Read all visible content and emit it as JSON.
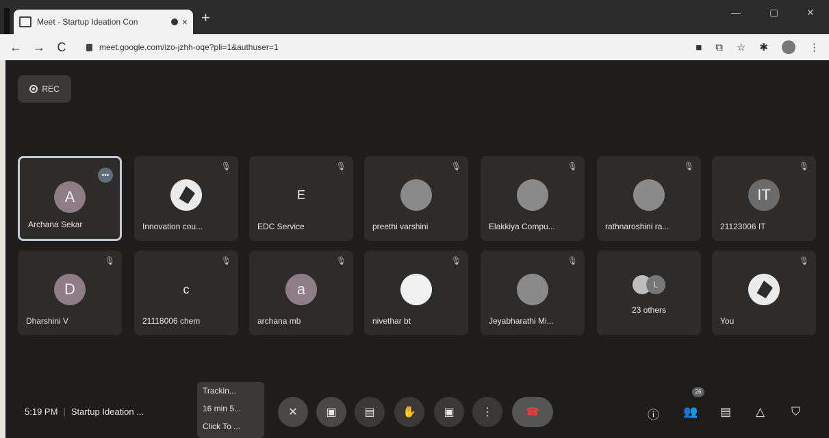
{
  "browser": {
    "tab_title": "Meet - Startup Ideation Con",
    "tab_close": "×",
    "new_tab": "+",
    "url": "meet.google.com/izo-jzhh-oqe?pli=1&authuser=1",
    "nav": {
      "back": "←",
      "forward": "→",
      "reload": "C"
    },
    "toolbar_icons": [
      "camera-icon",
      "share-page-icon",
      "star-icon",
      "extensions-icon",
      "profile-avatar",
      "menu-icon"
    ],
    "toolbar_glyphs": {
      "star": "☆",
      "more": "⋮"
    }
  },
  "meeting": {
    "rec_label": "REC",
    "tiles": [
      {
        "name": "Archana Sekar",
        "initial": "A",
        "avatar": "mauve",
        "active": true,
        "speaking": true
      },
      {
        "name": "Innovation cou...",
        "initial": "",
        "avatar": "logo"
      },
      {
        "name": "EDC Service",
        "initial": "E",
        "avatar": "none"
      },
      {
        "name": "preethi varshini",
        "initial": "",
        "avatar": "photo"
      },
      {
        "name": "Elakkiya Compu...",
        "initial": "",
        "avatar": "photo"
      },
      {
        "name": "rathnaroshini ra...",
        "initial": "",
        "avatar": "photo"
      },
      {
        "name": "21123006 IT",
        "initial": "IT",
        "avatar": "grey"
      },
      {
        "name": "Dharshini V",
        "initial": "D",
        "avatar": "mauve"
      },
      {
        "name": "21118006 chem",
        "initial": "c",
        "avatar": "none"
      },
      {
        "name": "archana mb",
        "initial": "a",
        "avatar": "mauve"
      },
      {
        "name": "nivethar bt",
        "initial": "",
        "avatar": "white"
      },
      {
        "name": "Jeyabharathi Mi...",
        "initial": "",
        "avatar": "photo"
      },
      {
        "name": "23 others",
        "initial": "L",
        "avatar": "group"
      },
      {
        "name": "You",
        "initial": "",
        "avatar": "logo"
      }
    ],
    "time": "5:19 PM",
    "separator": "|",
    "meeting_title": "Startup Ideation ...",
    "tracking": [
      "Trackin...",
      "16 min 5...",
      "Click To ..."
    ],
    "participant_count": "26",
    "controls": [
      "mic-off-icon",
      "camera-off-icon",
      "captions-icon",
      "raise-hand-icon",
      "present-icon",
      "more-options-icon",
      "hang-up-icon"
    ],
    "right_controls": [
      "info-icon",
      "people-icon",
      "chat-icon",
      "activities-icon",
      "host-controls-icon"
    ]
  }
}
